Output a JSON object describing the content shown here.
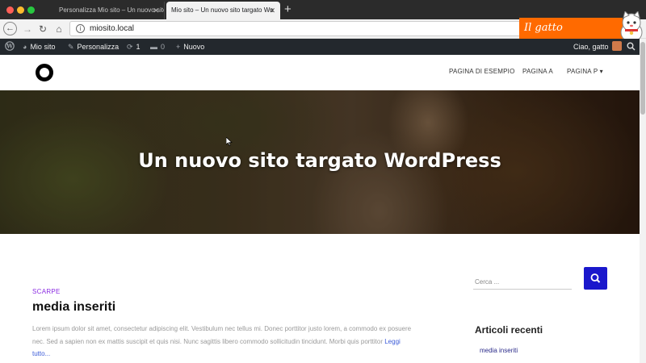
{
  "browser": {
    "tabs": [
      {
        "label": "Personalizza Mio sito – Un nuovo sito",
        "active": false
      },
      {
        "label": "Mio sito – Un nuovo sito targato Wo",
        "active": true
      }
    ],
    "url": "miosito.local"
  },
  "watermark": {
    "text": "Il gatto WordPress"
  },
  "admin_bar": {
    "site_name": "Mio sito",
    "customize": "Personalizza",
    "updates_count": "1",
    "comments_count": "0",
    "new_label": "Nuovo",
    "greeting": "Ciao, gatto"
  },
  "site_menu": [
    "PAGINA DI ESEMPIO",
    "PAGINA A",
    "PAGINA P"
  ],
  "hero": {
    "title": "Un nuovo sito targato WordPress"
  },
  "post": {
    "category": "SCARPE",
    "title": "media inseriti",
    "excerpt": "Lorem ipsum dolor sit amet, consectetur adipiscing elit. Vestibulum nec tellus mi. Donec porttitor justo lorem, a commodo ex posuere nec. Sed a sapien non ex mattis suscipit et quis nisi. Nunc sagittis libero commodo sollicitudin tincidunt. Morbi quis porttitor",
    "read_more": "Leggi tutto..."
  },
  "sidebar": {
    "search_placeholder": "Cerca ...",
    "recent_title": "Articoli recenti",
    "recent_items": [
      "media inseriti"
    ]
  },
  "colors": {
    "accent": "#1a18cc",
    "category": "#8a2be2",
    "admin_bar": "#23282d",
    "watermark": "#ff6a00"
  }
}
